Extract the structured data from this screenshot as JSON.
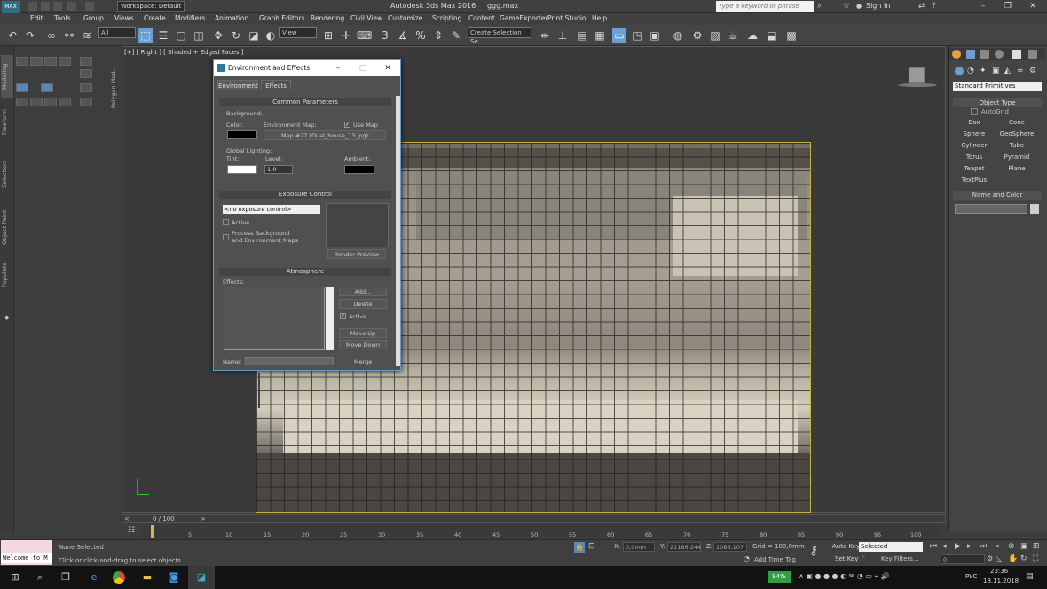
{
  "title_bar": {
    "workspace": "Workspace: Default",
    "app_title": "Autodesk 3ds Max 2016",
    "file_name": "ggg.max",
    "search_placeholder": "Type a keyword or phrase",
    "sign_in": "Sign In",
    "logo": "MAX"
  },
  "menu": [
    "Edit",
    "Tools",
    "Group",
    "Views",
    "Create",
    "Modifiers",
    "Animation",
    "Graph Editors",
    "Rendering",
    "Civil View",
    "Customize",
    "Scripting",
    "Content",
    "GameExporter",
    "Print Studio",
    "Help"
  ],
  "toolbar": {
    "selection_filter": "All",
    "ref_coord": "View",
    "named_selection": "Create Selection Se"
  },
  "ribbon_tabs": [
    "Modeling",
    "Freeform",
    "Selection",
    "Object Paint",
    "Populate"
  ],
  "polygon_tab": "Polygon Mod...",
  "viewport": {
    "label": "[+] [ Right ] [ Shaded + Edged Faces ]"
  },
  "command_panel": {
    "primitive_type": "Standard Primitives",
    "object_type_title": "Object Type",
    "autogrid": "AutoGrid",
    "buttons": [
      "Box",
      "Cone",
      "Sphere",
      "GeoSphere",
      "Cylinder",
      "Tube",
      "Torus",
      "Pyramid",
      "Teapot",
      "Plane",
      "TextPlus"
    ],
    "name_color_title": "Name and Color"
  },
  "dialog": {
    "title": "Environment and Effects",
    "tabs": [
      "Environment",
      "Effects"
    ],
    "common_params": "Common Parameters",
    "background": "Background:",
    "color": "Color:",
    "env_map": "Environment Map:",
    "use_map": "Use Map",
    "map_button": "Map #27 (Dual_house_13.jpg)",
    "global_lighting": "Global Lighting:",
    "tint": "Tint:",
    "level": "Level:",
    "level_value": "1,0",
    "ambient": "Ambient:",
    "exposure_control": "Exposure Control",
    "exposure_select": "<no exposure control>",
    "active": "Active",
    "process_bg": "Process Background",
    "env_maps": "and Environment Maps",
    "render_preview": "Render Preview",
    "atmosphere": "Atmosphere",
    "effects": "Effects:",
    "add": "Add...",
    "delete": "Delete",
    "atm_active": "Active",
    "move_up": "Move Up",
    "move_down": "Move Down",
    "name": "Name:",
    "merge": "Merge"
  },
  "timeline": {
    "frame_counter": "0 / 100",
    "ticks": [
      "0",
      "5",
      "10",
      "15",
      "20",
      "25",
      "30",
      "35",
      "40",
      "45",
      "50",
      "55",
      "60",
      "65",
      "70",
      "75",
      "80",
      "85",
      "90",
      "95",
      "100"
    ]
  },
  "status": {
    "maxscript": "Welcome to M",
    "selection": "None Selected",
    "prompt": "Click or click-and-drag to select objects",
    "x_label": "X:",
    "x_value": "0,0mm",
    "y_label": "Y:",
    "y_value": "21186,244",
    "z_label": "Z:",
    "z_value": "2086,107",
    "grid": "Grid = 100,0mm",
    "add_time_tag": "Add Time Tag",
    "auto_key": "Auto Key",
    "set_key": "Set Key",
    "selected": "Selected",
    "key_filters": "Key Filters...",
    "frame": "0"
  },
  "taskbar": {
    "battery": "94%",
    "lang": "РУС",
    "time": "23:36",
    "date": "18.11.2018"
  }
}
